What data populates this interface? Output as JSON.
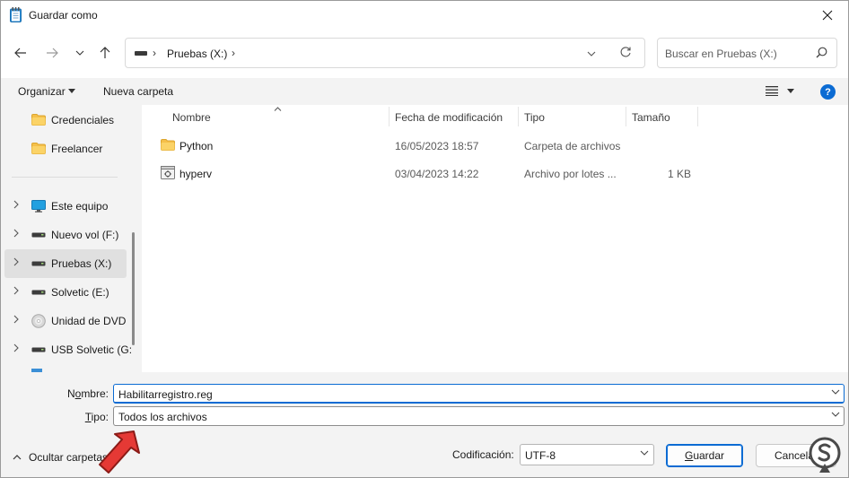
{
  "window": {
    "title": "Guardar como"
  },
  "navigation": {
    "address_path": "Pruebas (X:)",
    "search_placeholder": "Buscar en Pruebas (X:)"
  },
  "commands": {
    "organize": "Organizar",
    "new_folder": "Nueva carpeta"
  },
  "sidebar": {
    "items": [
      {
        "label": "Credenciales",
        "icon": "folder-icon"
      },
      {
        "label": "Freelancer",
        "icon": "folder-icon"
      },
      {
        "label": "Este equipo",
        "icon": "monitor-icon"
      },
      {
        "label": "Nuevo vol (F:)",
        "icon": "drive-icon"
      },
      {
        "label": "Pruebas (X:)",
        "icon": "drive-icon",
        "selected": true
      },
      {
        "label": "Solvetic (E:)",
        "icon": "drive-icon"
      },
      {
        "label": "Unidad de DVD",
        "icon": "dvd-icon"
      },
      {
        "label": "USB Solvetic (G:",
        "icon": "drive-icon"
      }
    ]
  },
  "columns": {
    "name": "Nombre",
    "modified": "Fecha de modificación",
    "type": "Tipo",
    "size": "Tamaño"
  },
  "files": [
    {
      "name": "Python",
      "modified": "16/05/2023 18:57",
      "type": "Carpeta de archivos",
      "size": "",
      "icon": "folder-icon"
    },
    {
      "name": "hyperv",
      "modified": "03/04/2023 14:22",
      "type": "Archivo por lotes ...",
      "size": "1 KB",
      "icon": "batch-file-icon"
    }
  ],
  "form": {
    "name_label_pre": "N",
    "name_label_ul": "o",
    "name_label_post": "mbre:",
    "name_value": "Habilitarregistro.reg",
    "type_label_ul": "T",
    "type_label_post": "ipo:",
    "type_value": "Todos los archivos"
  },
  "footer": {
    "hide_folders": "Ocultar carpetas",
    "encoding_label": "Codificación:",
    "encoding_value": "UTF-8",
    "save_ul": "G",
    "save_post": "uardar",
    "cancel": "Cancelar"
  },
  "colors": {
    "accent": "#0b6bd3",
    "folder": "#f5c04a",
    "annotation_arrow": "#e53935"
  }
}
